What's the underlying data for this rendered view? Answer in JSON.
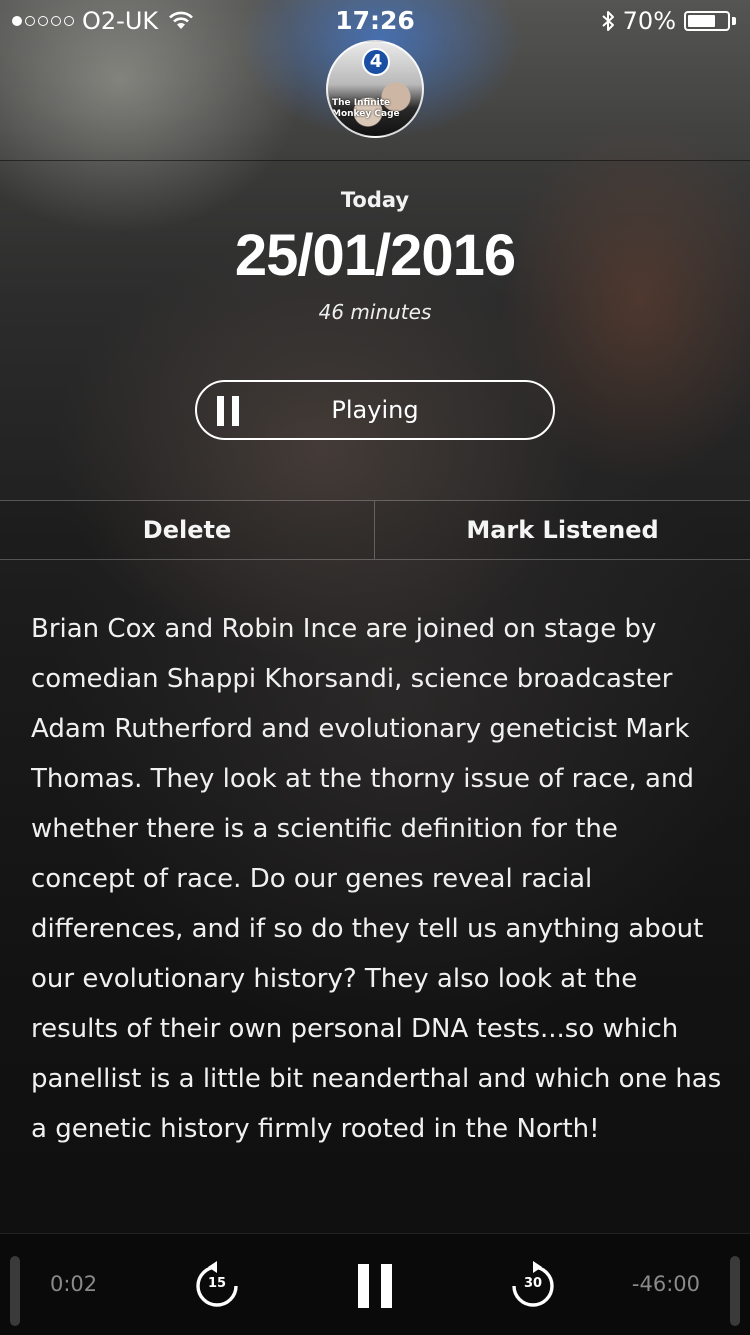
{
  "status_bar": {
    "carrier": "O2-UK",
    "time": "17:26",
    "battery": "70%",
    "battery_level": 0.7,
    "signal_dots_filled": 1,
    "signal_dots_total": 5
  },
  "episode": {
    "artwork_badge": "4",
    "artwork_text": "The Infinite Monkey Cage",
    "date_label": "Today",
    "date": "25/01/2016",
    "duration": "46 minutes",
    "play_state_label": "Playing",
    "description": "Brian Cox and Robin Ince are joined on stage by comedian Shappi Khorsandi, science broadcaster Adam Rutherford and evolutionary geneticist Mark Thomas. They look at the thorny issue of race, and whether there is a scientific definition for the concept of race. Do our genes reveal racial differences, and if so do they tell us anything about our evolutionary history? They also look at the results of their own personal DNA tests...so which panellist is a little bit neanderthal and which one has a genetic history firmly rooted in the North!"
  },
  "actions": {
    "delete_label": "Delete",
    "mark_listened_label": "Mark Listened"
  },
  "player": {
    "elapsed": "0:02",
    "remaining": "-46:00",
    "skip_back_label": "15",
    "skip_forward_label": "30"
  },
  "icons": {
    "wifi": "wifi-icon",
    "bluetooth": "bluetooth-icon",
    "battery": "battery-icon",
    "pause": "pause-icon",
    "skip_back": "skip-back-15-icon",
    "skip_forward": "skip-forward-30-icon"
  }
}
